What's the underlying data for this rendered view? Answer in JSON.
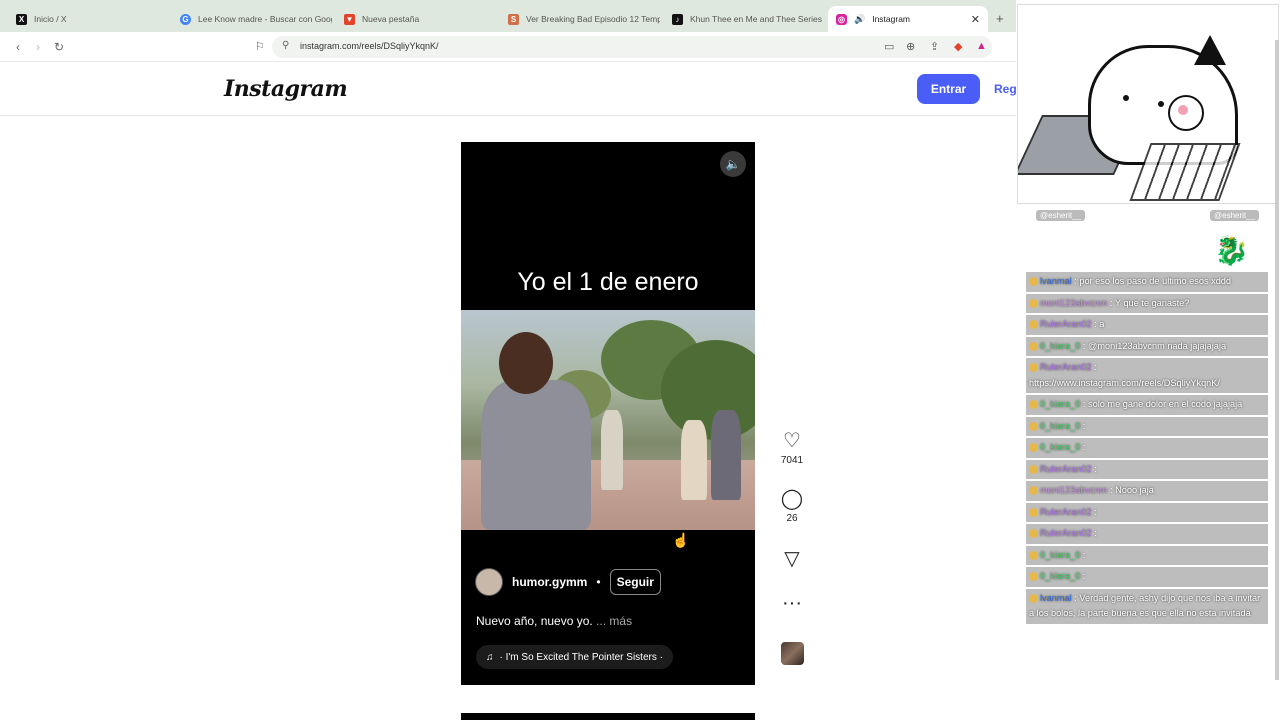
{
  "browser": {
    "tabs": [
      {
        "title": "Inicio / X",
        "icon": "x-logo-icon",
        "color": "#111111"
      },
      {
        "title": "Lee Know madre - Buscar con Googl",
        "icon": "google-icon",
        "color": "#4285f4"
      },
      {
        "title": "Nueva pestaña",
        "icon": "brave-icon",
        "color": "#e2432b"
      },
      {
        "title": "Ver Breaking Bad Episodio 12 Tempo",
        "icon": "site-icon",
        "color": "#d0704a"
      },
      {
        "title": "Khun Thee en Me and Thee Series EP",
        "icon": "tiktok-icon",
        "color": "#111111"
      },
      {
        "title": "Instagram",
        "icon": "instagram-icon",
        "color": "#d6249f"
      }
    ],
    "new_tab": "+",
    "url": "instagram.com/reels/DSqliyYkqnK/"
  },
  "instagram": {
    "logo": "Instagram",
    "login_label": "Entrar",
    "register_label": "Reg",
    "reel": {
      "overlay_text": "Yo el 1 de enero",
      "username": "humor.gymm",
      "separator": "•",
      "follow_label": "Seguir",
      "description": "Nuevo año, nuevo yo.",
      "more_label": "... más",
      "audio": "· I'm So Excited  The Pointer Sisters ·"
    },
    "actions": {
      "likes": "7041",
      "comments": "26"
    }
  },
  "stream": {
    "social_left": "@esherit__",
    "social_right": "@esherit__",
    "chat": [
      {
        "user": "lvanmal",
        "text": ": por eso los paso de ultimo esos xddd",
        "color": "#3a6fd8"
      },
      {
        "user": "moni123abvcnm",
        "text": ": Y que te ganaste?",
        "color": "#c08fd6"
      },
      {
        "user": "RulerAran02",
        "text": ": a",
        "color": "#b278e8"
      },
      {
        "user": "0_kiara_0",
        "text": ": @moni123abvcnm nada jajajajaja",
        "color": "#4bd16a"
      },
      {
        "user": "RulerAran02",
        "text": ": https://www.instagram.com/reels/DSqliyYkqnK/",
        "color": "#b278e8"
      },
      {
        "user": "0_kiara_0",
        "text": ": solo me gane dolor en el codo jajajaja",
        "color": "#4bd16a"
      },
      {
        "user": "0_kiara_0",
        "text": ":",
        "color": "#4bd16a"
      },
      {
        "user": "0_kiara_0",
        "text": ":",
        "color": "#4bd16a"
      },
      {
        "user": "RulerAran02",
        "text": ":",
        "color": "#b278e8"
      },
      {
        "user": "moni123abvcnm",
        "text": ": Nooo jaja",
        "color": "#c08fd6"
      },
      {
        "user": "RulerAran02",
        "text": ":",
        "color": "#b278e8"
      },
      {
        "user": "RulerAran02",
        "text": ":",
        "color": "#b278e8"
      },
      {
        "user": "0_kiara_0",
        "text": ":",
        "color": "#4bd16a"
      },
      {
        "user": "0_kiara_0",
        "text": ":",
        "color": "#4bd16a"
      },
      {
        "user": "lvanmal",
        "text": ": Verdad gente, ashy dijo que nos iba a invitar a los bolos, la parte buena es que ella no esta invitada",
        "color": "#3a6fd8"
      }
    ]
  }
}
